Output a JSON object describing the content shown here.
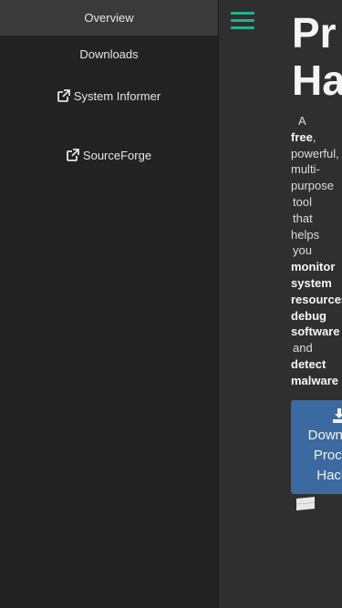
{
  "sidebar": {
    "items": [
      {
        "label": "Overview",
        "active": true
      },
      {
        "label": "Downloads"
      },
      {
        "label": "System Informer",
        "icon": "external-link-icon"
      },
      {
        "label": "SourceForge",
        "icon": "external-link-icon"
      }
    ]
  },
  "main": {
    "title": "Process Hacker",
    "title_line1": "Pr",
    "title_line2": "Ha",
    "tagline": {
      "w1": "A",
      "w2": "free",
      "w2_suffix": ",",
      "w3": "powerful,",
      "w4": "multi-",
      "w5": "purpose",
      "w6": "tool",
      "w7": "that",
      "w8": "helps",
      "w9": "you",
      "w10": "monitor",
      "w11": "system",
      "w12": "resources,",
      "w13": "debug",
      "w14": "software",
      "w15": "and",
      "w16": "detect",
      "w17": "malware"
    },
    "download_button": {
      "line1": "Download",
      "line2": "Process",
      "line3": "Hacker",
      "icon": "download-icon"
    },
    "os_icon": "windows-icon"
  },
  "colors": {
    "accent": "#1fb58f",
    "button": "#3b6aa0",
    "sidebar_bg": "#222222",
    "active_item_bg": "#3a3a3a"
  }
}
